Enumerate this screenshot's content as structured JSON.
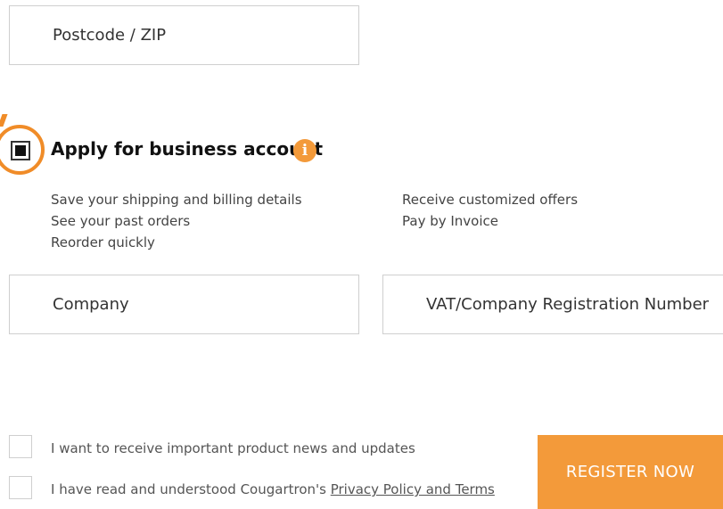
{
  "form": {
    "postcode_placeholder": "Postcode / ZIP",
    "company_placeholder": "Company",
    "vat_placeholder": "VAT/Company Registration Number"
  },
  "business": {
    "checked": true,
    "title": "Apply for business account",
    "info_icon_glyph": "i",
    "benefits_left": [
      "Save your shipping and billing details",
      "See your past orders",
      "Reorder quickly"
    ],
    "benefits_right": [
      "Receive customized offers",
      "Pay by Invoice"
    ]
  },
  "consent": {
    "news_label": "I want to receive important product news and updates",
    "terms_prefix": "I have read and understood Cougartron's ",
    "terms_link": "Privacy Policy and Terms"
  },
  "actions": {
    "register_label": "REGISTER NOW"
  },
  "colors": {
    "accent": "#f39a3a",
    "highlight": "#f08c28",
    "border": "#cfcfcf"
  }
}
